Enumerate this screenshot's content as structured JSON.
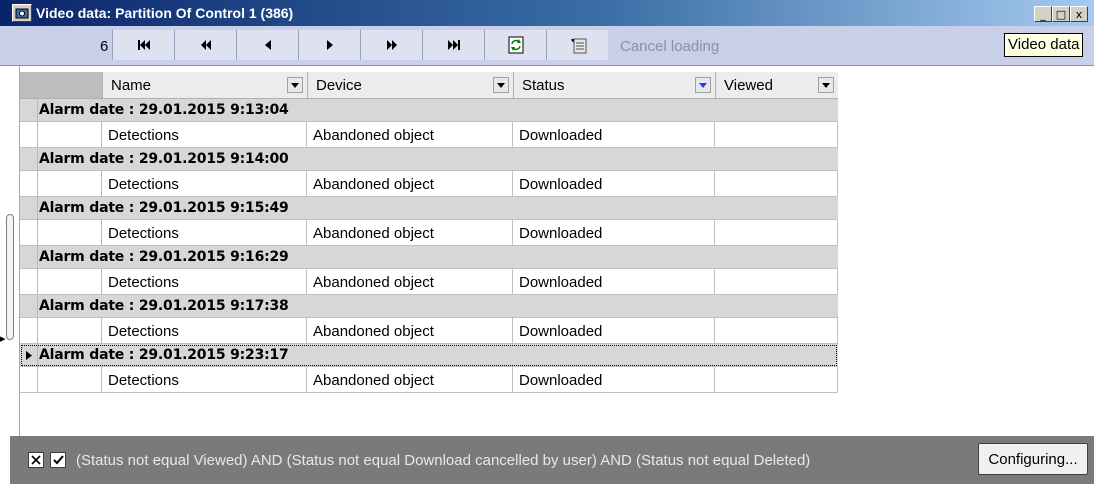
{
  "window": {
    "title": "Video data: Partition  Of Control 1 (386)",
    "app_icon": "camera-icon",
    "buttons": {
      "minimize": "_",
      "maximize": "□",
      "close": "x"
    }
  },
  "toolbar": {
    "record_count": "6",
    "buttons": [
      {
        "name": "first-record-button",
        "icon": "skip-to-first-icon"
      },
      {
        "name": "fast-back-button",
        "icon": "fast-rewind-icon"
      },
      {
        "name": "prev-record-button",
        "icon": "step-back-icon"
      },
      {
        "name": "next-record-button",
        "icon": "step-forward-icon"
      },
      {
        "name": "fast-forward-button",
        "icon": "fast-forward-icon"
      },
      {
        "name": "last-record-button",
        "icon": "skip-to-last-icon"
      },
      {
        "name": "refresh-button",
        "icon": "refresh-icon"
      },
      {
        "name": "filter-button",
        "icon": "filter-icon"
      },
      {
        "name": "columns-button",
        "icon": "list-icon"
      }
    ],
    "cancel_loading": "Cancel loading",
    "tooltip": "Video data"
  },
  "grid": {
    "columns": [
      "Name",
      "Device",
      "Status",
      "Viewed"
    ],
    "groups": [
      {
        "label": "Alarm date : 29.01.2015 9:13:04",
        "row": {
          "name": "Detections",
          "device": "Abandoned object",
          "status": "Downloaded",
          "viewed": ""
        }
      },
      {
        "label": "Alarm date : 29.01.2015 9:14:00",
        "row": {
          "name": "Detections",
          "device": "Abandoned object",
          "status": "Downloaded",
          "viewed": ""
        }
      },
      {
        "label": "Alarm date : 29.01.2015 9:15:49",
        "row": {
          "name": "Detections",
          "device": "Abandoned object",
          "status": "Downloaded",
          "viewed": ""
        }
      },
      {
        "label": "Alarm date : 29.01.2015 9:16:29",
        "row": {
          "name": "Detections",
          "device": "Abandoned object",
          "status": "Downloaded",
          "viewed": ""
        }
      },
      {
        "label": "Alarm date : 29.01.2015 9:17:38",
        "row": {
          "name": "Detections",
          "device": "Abandoned object",
          "status": "Downloaded",
          "viewed": ""
        }
      },
      {
        "label": "Alarm date : 29.01.2015 9:23:17",
        "row": {
          "name": "Detections",
          "device": "Abandoned object",
          "status": "Downloaded",
          "viewed": ""
        }
      }
    ],
    "active_group": 5
  },
  "filter": {
    "text": "(Status not equal Viewed) AND (Status not equal Download cancelled by user) AND (Status not equal Deleted)",
    "configure_label": "Configuring..."
  },
  "colors": {
    "title_gradient_start": "#0a246a",
    "toolbar_bg": "#c8cfe8",
    "group_bg": "#d7d7d7",
    "filter_bar_bg": "#7a7a7a"
  }
}
